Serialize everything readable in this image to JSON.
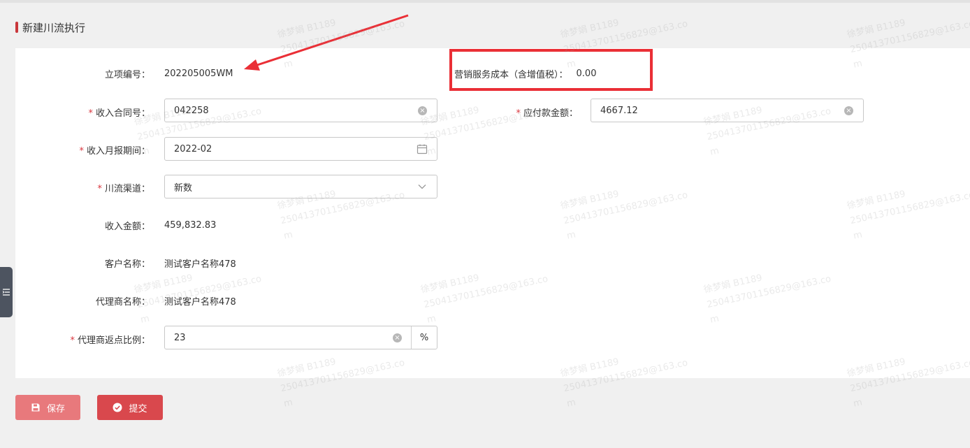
{
  "section": {
    "title": "新建川流执行"
  },
  "form": {
    "project_no": {
      "label": "立项编号：",
      "value": "202205005WM"
    },
    "marketing_cost": {
      "label": "营销服务成本（含增值税）：",
      "value": "0.00"
    },
    "contract_no": {
      "label": "收入合同号：",
      "value": "042258"
    },
    "payable": {
      "label": "应付款金额：",
      "value": "4667.12"
    },
    "report_period": {
      "label": "收入月报期间：",
      "value": "2022-02"
    },
    "channel": {
      "label": "川流渠道：",
      "value": "新数"
    },
    "income_amount": {
      "label": "收入金额：",
      "value": "459,832.83"
    },
    "customer_name": {
      "label": "客户名称：",
      "value": "测试客户名称478"
    },
    "agent_name": {
      "label": "代理商名称：",
      "value": "测试客户名称478"
    },
    "rebate_ratio": {
      "label": "代理商返点比例：",
      "value": "23",
      "unit": "%"
    },
    "required_mark": "*"
  },
  "buttons": {
    "save": "保存",
    "submit": "提交"
  },
  "watermark": {
    "line1": "徐梦娟 B1189",
    "line2": "250413701156829@163.co",
    "line3": "m"
  },
  "colors": {
    "accent": "#c9373b",
    "highlight_border": "#ea2f36",
    "save_button": "#e8797c",
    "submit_button": "#d9484d"
  },
  "icons": [
    "clear-icon",
    "calendar-icon",
    "chevron-down-icon",
    "menu-icon",
    "save-icon",
    "check-circle-icon",
    "arrow-annotation"
  ]
}
